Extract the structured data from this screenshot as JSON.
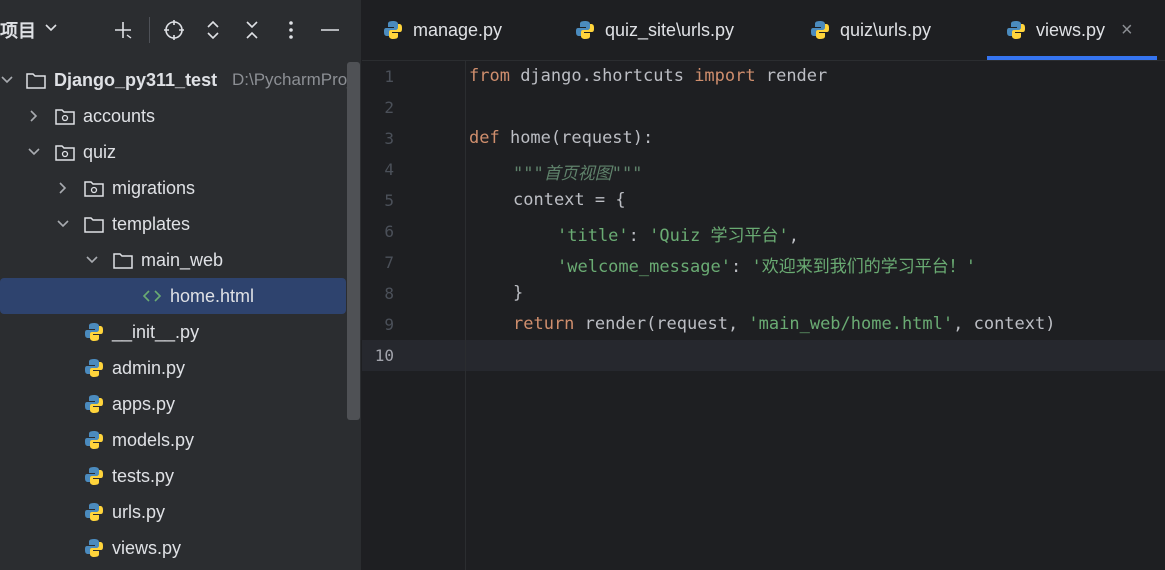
{
  "sidebar": {
    "header": {
      "title": "项目"
    },
    "tree": [
      {
        "label": "Django_py311_test",
        "path": "D:\\PycharmProj",
        "bold": true
      },
      {
        "label": "accounts"
      },
      {
        "label": "quiz"
      },
      {
        "label": "migrations"
      },
      {
        "label": "templates"
      },
      {
        "label": "main_web"
      },
      {
        "label": "home.html"
      },
      {
        "label": "__init__.py"
      },
      {
        "label": "admin.py"
      },
      {
        "label": "apps.py"
      },
      {
        "label": "models.py"
      },
      {
        "label": "tests.py"
      },
      {
        "label": "urls.py"
      },
      {
        "label": "views.py"
      }
    ]
  },
  "tabs": [
    {
      "label": "manage.py"
    },
    {
      "label": "quiz_site\\urls.py"
    },
    {
      "label": "quiz\\urls.py"
    },
    {
      "label": "views.py",
      "active": true,
      "close": "×"
    }
  ],
  "editor": {
    "line_numbers": [
      "1",
      "2",
      "3",
      "4",
      "5",
      "6",
      "7",
      "8",
      "9",
      "10"
    ],
    "current_line": "10",
    "lines": {
      "l1": {
        "kw1": "from",
        "t1": " django.shortcuts ",
        "kw2": "import",
        "t2": " render"
      },
      "l3": {
        "kw": "def",
        "t": " home(request):"
      },
      "l4": {
        "doc": "\"\"\"首页视图\"\"\""
      },
      "l5": {
        "t": "context = {"
      },
      "l6": {
        "s1": "'title'",
        "t1": ": ",
        "s2": "'Quiz 学习平台'",
        "t2": ","
      },
      "l7": {
        "s1": "'welcome_message'",
        "t1": ": ",
        "s2": "'欢迎来到我们的学习平台！'"
      },
      "l8": {
        "t": "}"
      },
      "l9": {
        "kw": "return",
        "t1": " render(request, ",
        "s": "'main_web/home.html'",
        "t2": ", context)"
      }
    }
  },
  "colors": {
    "keyword": "#cf8e6d",
    "string": "#6aab73",
    "docstring": "#5f826b",
    "selection": "#2e436e",
    "accent": "#3574f0"
  }
}
